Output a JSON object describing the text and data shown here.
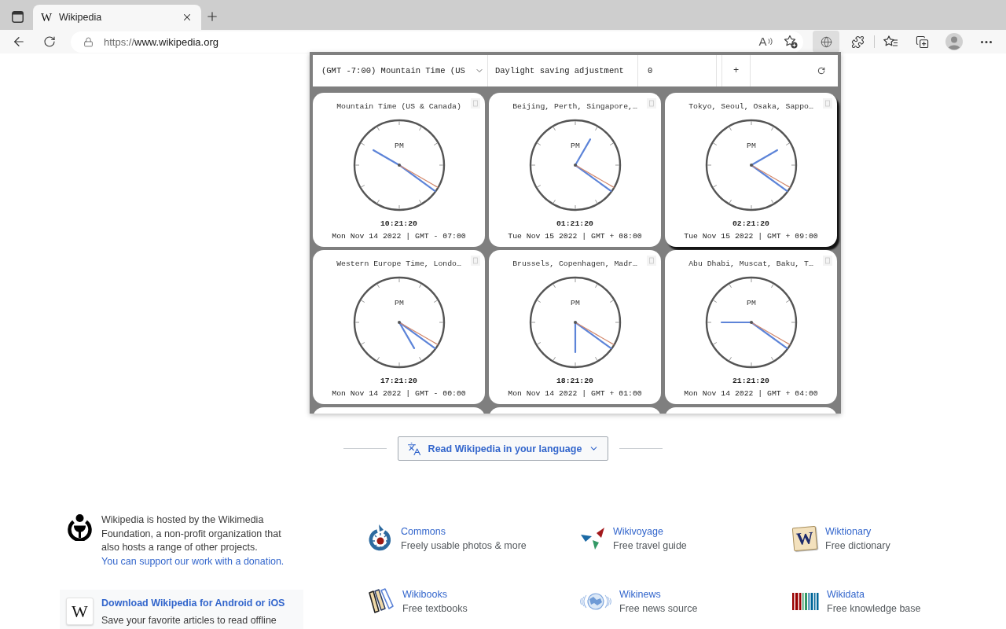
{
  "browser": {
    "tabs": [
      {
        "favicon_letter": "W",
        "title": "Wikipedia",
        "selected": true
      }
    ],
    "address_bar": {
      "scheme": "https://",
      "host": "www.wikipedia.org",
      "read_aloud_letter": "A"
    },
    "extension_button": {
      "active": true
    }
  },
  "clock_panel": {
    "timezone_select": "(GMT -7:00) Mountain Time (US",
    "dst_label": "Daylight saving adjustment",
    "dst_value": "0",
    "add_button": "+",
    "clocks": [
      {
        "title": "Mountain Time (US & Canada)",
        "period": "PM",
        "time": "10:21:20",
        "date": "Mon Nov 14 2022 | GMT - 07:00",
        "hovered": false
      },
      {
        "title": "Beijing, Perth, Singapore,…",
        "period": "PM",
        "time": "01:21:20",
        "date": "Tue Nov 15 2022 | GMT + 08:00",
        "hovered": false
      },
      {
        "title": "Tokyo, Seoul, Osaka, Sappo…",
        "period": "PM",
        "time": "02:21:20",
        "date": "Tue Nov 15 2022 | GMT + 09:00",
        "hovered": true
      },
      {
        "title": "Western Europe Time, Londo…",
        "period": "PM",
        "time": "17:21:20",
        "date": "Mon Nov 14 2022 | GMT - 00:00",
        "hovered": false
      },
      {
        "title": "Brussels, Copenhagen, Madr…",
        "period": "PM",
        "time": "18:21:20",
        "date": "Mon Nov 14 2022 | GMT + 01:00",
        "hovered": false
      },
      {
        "title": "Abu Dhabi, Muscat, Baku, T…",
        "period": "PM",
        "time": "21:21:20",
        "date": "Mon Nov 14 2022 | GMT + 04:00",
        "hovered": false
      }
    ],
    "more_below": true
  },
  "language_button": "Read Wikipedia in your language",
  "footer": {
    "about": {
      "text": "Wikipedia is hosted by the Wikimedia Foundation, a non-profit organization that also hosts a range of other projects.",
      "link": "You can support our work with a donation."
    },
    "app_promo": {
      "logo_letter": "W",
      "title": "Download Wikipedia for Android or iOS",
      "text": "Save your favorite articles to read offline"
    },
    "projects": [
      {
        "kind": "commons",
        "name": "Commons",
        "tagline": "Freely usable photos & more"
      },
      {
        "kind": "wikivoyage",
        "name": "Wikivoyage",
        "tagline": "Free travel guide"
      },
      {
        "kind": "wiktionary",
        "logo_letter": "W",
        "name": "Wiktionary",
        "tagline": "Free dictionary"
      },
      {
        "kind": "wikibooks",
        "name": "Wikibooks",
        "tagline": "Free textbooks"
      },
      {
        "kind": "wikinews",
        "name": "Wikinews",
        "tagline": "Free news source"
      },
      {
        "kind": "wikidata",
        "name": "Wikidata",
        "tagline": "Free knowledge base"
      }
    ]
  }
}
